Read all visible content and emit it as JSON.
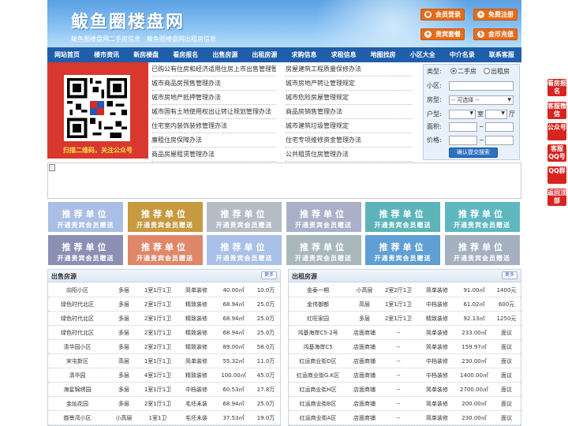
{
  "header": {
    "title": "鲅鱼圈楼盘网",
    "subtitle": "鲅鱼圈楼盘网二手房信息　鲅鱼圈楼盘网出租房信息",
    "buttons": [
      {
        "label": "会员登录",
        "icon": "user-icon"
      },
      {
        "label": "免费注册",
        "icon": "register-icon"
      },
      {
        "label": "贵宾套餐",
        "icon": "vip-icon"
      },
      {
        "label": "金币充值",
        "icon": "coin-icon"
      }
    ]
  },
  "nav": [
    "网站首页",
    "楼市资讯",
    "新房楼盘",
    "看房报名",
    "出售房源",
    "出租房源",
    "求购信息",
    "求租信息",
    "地图找房",
    "小区大全",
    "中介名录",
    "联系客服"
  ],
  "qr": {
    "caption": "扫描二维码，关注公众号"
  },
  "links": [
    [
      "已购公有住房和经济适用住房上市出售管理暂",
      "房屋建筑工程质量保修办法"
    ],
    [
      "城市商品房预售管理办法",
      "城市房地产转让管理规定"
    ],
    [
      "城市房地产抵押管理办法",
      "城市危险房屋管理规定"
    ],
    [
      "城市国有土地使用权出让转让规划管理办法",
      "商品房销售管理办法"
    ],
    [
      "住宅室内装饰装修管理办法",
      "城市建筑垃圾管理规定"
    ],
    [
      "廉租住房保障办法",
      "住宅专项维修资金管理办法"
    ],
    [
      "商品房屋租赁管理办法",
      "公共租赁住房管理办法"
    ]
  ],
  "search": {
    "type_label": "类型:",
    "opt_sale": "二手房",
    "opt_rent": "出租房",
    "community_label": "小区:",
    "house_type_label": "房型:",
    "house_type_value": "-- 可选择 --",
    "layout_label": "户型:",
    "room_unit": "室",
    "hall_unit": "厅",
    "area_label": "面积:",
    "price_label": "价格:",
    "range_sep": "~",
    "submit_label": "确认提交搜索"
  },
  "ads": {
    "title": "推荐单位",
    "text": "开通贵宾会员赠送",
    "colors": [
      "#a9bfe6",
      "#c79a3f",
      "#b6bcc6",
      "#aab0c9",
      "#5cb4b9",
      "#5fb8c0",
      "#8c8fb4",
      "#e0876a",
      "#a9c0e8",
      "#a9b8bb",
      "#5f9fd4",
      "#a4b0c0"
    ]
  },
  "sale": {
    "title": "出售房源",
    "more": "更多",
    "rows": [
      [
        "向阳小区",
        "多层",
        "1室1厅1卫",
        "简单装修",
        "40.00㎡",
        "10.0万"
      ],
      [
        "绿色时代北区",
        "多层",
        "2室1厅1卫",
        "精致装修",
        "68.94㎡",
        "25.0万"
      ],
      [
        "绿色时代北区",
        "多层",
        "2室1厅1卫",
        "精致装修",
        "68.94㎡",
        "25.0万"
      ],
      [
        "绿色时代北区",
        "多层",
        "2室1厅1卫",
        "精致装修",
        "68.94㎡",
        "25.0万"
      ],
      [
        "清华园小区",
        "多层",
        "2室2厅1卫",
        "精致装修",
        "89.00㎡",
        "58.0万"
      ],
      [
        "宋屯新区",
        "高层",
        "1室1厅1卫",
        "简单装修",
        "55.32㎡",
        "11.0万"
      ],
      [
        "清华园",
        "多层",
        "4室1厅1卫",
        "精致装修",
        "100.00㎡",
        "45.0万"
      ],
      [
        "海星锦绣园",
        "多层",
        "1室1厅1卫",
        "中档装修",
        "60.53㎡",
        "17.8万"
      ],
      [
        "金灿花园",
        "多层",
        "2室1厅1卫",
        "毛坯未装",
        "68.94㎡",
        "25.0万"
      ],
      [
        "御景湾小区",
        "小高层",
        "1室1卫",
        "毛坯未装",
        "37.53㎡",
        "19.0万"
      ]
    ]
  },
  "rent": {
    "title": "出租房源",
    "more": "更多",
    "rows": [
      [
        "金泰一期",
        "小高层",
        "2室2厅1卫",
        "简单装修",
        "91.00㎡",
        "1400元"
      ],
      [
        "金伟御都",
        "高层",
        "1室1厅1卫",
        "中档装修",
        "61.02㎡",
        "600元"
      ],
      [
        "红旺家园",
        "多层",
        "2室1厅1卫",
        "精致装修",
        "92.13㎡",
        "1250元"
      ],
      [
        "鸿基海岸C5-2号",
        "店面商铺",
        "--",
        "简单装修",
        "233.00㎡",
        "面议"
      ],
      [
        "鸿基海岸C5",
        "店面商铺",
        "--",
        "简单装修",
        "159.97㎡",
        "面议"
      ],
      [
        "红运商业街D区",
        "店面商铺",
        "--",
        "中档装修",
        "230.00㎡",
        "面议"
      ],
      [
        "红运商业街G.K区",
        "店面商铺",
        "--",
        "中档装修",
        "1400.00㎡",
        "面议"
      ],
      [
        "红运商业街H区",
        "店面商铺",
        "--",
        "简单装修",
        "2700.00㎡",
        "面议"
      ],
      [
        "红运商业街B区",
        "店面商铺",
        "--",
        "简单装修",
        "200.00㎡",
        "面议"
      ],
      [
        "红运商业街A区",
        "店面商铺",
        "--",
        "简单装修",
        "230.00㎡",
        "面议"
      ]
    ]
  },
  "side": [
    "看房报名",
    "客服微信",
    "公众号",
    "客服QQ号",
    "QQ群",
    "返回顶部"
  ]
}
